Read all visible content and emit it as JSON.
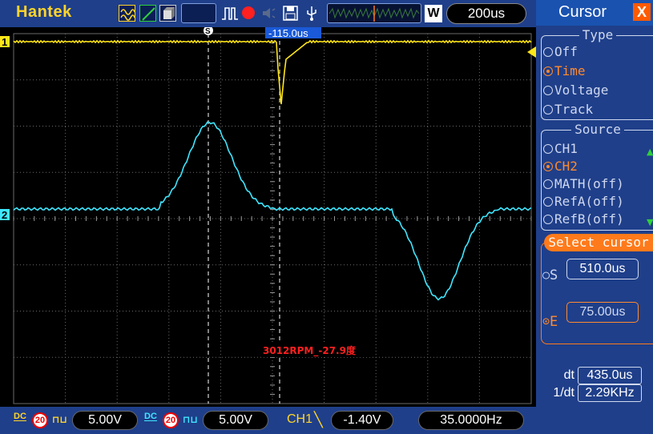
{
  "app": {
    "brand": "Hantek"
  },
  "toolbar": {
    "icons": [
      "acquire-wave-icon",
      "ramp-icon",
      "cube-icon",
      "blank-box",
      "trigger-pulse-icon",
      "record-dot-icon",
      "speaker-icon",
      "save-disk-icon",
      "usb-print-icon"
    ],
    "memory_window_label": "W",
    "timebase": "200us"
  },
  "scope": {
    "ch1_marker": "1",
    "ch2_marker": "2",
    "cursor_s_marker": "S",
    "trigger_time_readout": "-115.0us",
    "annotation": "3012RPM_-27.9度",
    "colors": {
      "ch1": "#ffe61a",
      "ch2": "#3fe6ff",
      "annotation": "#ff2020",
      "grid": "#6a6a6a"
    }
  },
  "bottom": {
    "ch1": {
      "coupling": "DC",
      "bw_limit": "20",
      "volts_div": "5.00V"
    },
    "ch2": {
      "coupling": "DC",
      "bw_limit": "20",
      "volts_div": "5.00V"
    },
    "trigger": {
      "source": "CH1",
      "edge": "╲",
      "level": "-1.40V"
    },
    "frequency": "35.0000Hz"
  },
  "panel": {
    "title": "Cursor",
    "close": "X",
    "type_group": {
      "title": "Type",
      "options": [
        "Off",
        "Time",
        "Voltage",
        "Track"
      ],
      "selected": "Time"
    },
    "source_group": {
      "title": "Source",
      "options": [
        "CH1",
        "CH2",
        "MATH(off)",
        "RefA(off)",
        "RefB(off)"
      ],
      "selected": "CH2"
    },
    "select_cursor": {
      "title": "Select cursor",
      "s_label": "S",
      "s_value": "510.0us",
      "e_label": "E",
      "e_value": "75.00us",
      "selected": "E"
    },
    "measure": {
      "dt_label": "dt",
      "dt_value": "435.0us",
      "inv_dt_label": "1/dt",
      "inv_dt_value": "2.29KHz"
    }
  }
}
